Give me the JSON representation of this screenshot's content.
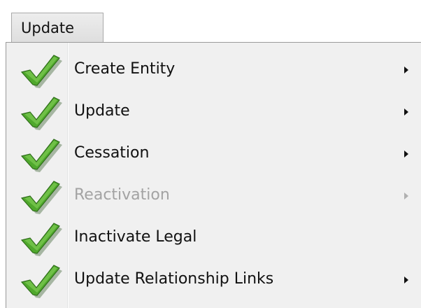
{
  "menubar": {
    "button_label": "Update"
  },
  "menu": {
    "items": [
      {
        "label": "Create Entity",
        "icon": "green-checkmark-icon",
        "has_submenu": true,
        "enabled": true
      },
      {
        "label": "Update",
        "icon": "green-checkmark-icon",
        "has_submenu": true,
        "enabled": true
      },
      {
        "label": "Cessation",
        "icon": "green-checkmark-icon",
        "has_submenu": true,
        "enabled": true
      },
      {
        "label": "Reactivation",
        "icon": "green-checkmark-icon",
        "has_submenu": true,
        "enabled": false
      },
      {
        "label": "Inactivate Legal",
        "icon": "green-checkmark-icon",
        "has_submenu": false,
        "enabled": true
      },
      {
        "label": "Update Relationship Links",
        "icon": "green-checkmark-icon",
        "has_submenu": true,
        "enabled": true
      }
    ]
  },
  "colors": {
    "check_green": "#4fa82c",
    "disabled_text": "#a3a3a3",
    "menu_background": "#f0f0f0"
  }
}
